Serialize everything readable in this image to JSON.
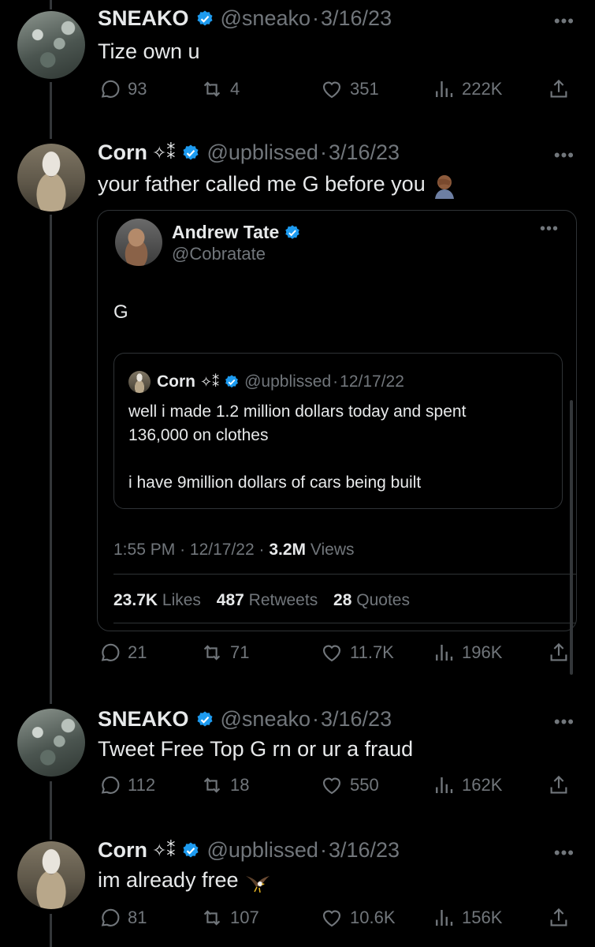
{
  "tweets": [
    {
      "name": "SNEAKO",
      "sparkles": "",
      "handle": "@sneako",
      "date": "3/16/23",
      "text": "Tize own u",
      "replies": "93",
      "retweets": "4",
      "likes": "351",
      "views": "222K"
    },
    {
      "name": "Corn",
      "sparkles": "✧⁑",
      "handle": "@upblissed",
      "date": "3/16/23",
      "text": "your father called me G before you",
      "text_emoji": "facepalm-emoji",
      "replies": "21",
      "retweets": "71",
      "likes": "11.7K",
      "views": "196K"
    },
    {
      "name": "SNEAKO",
      "sparkles": "",
      "handle": "@sneako",
      "date": "3/16/23",
      "text": "Tweet Free Top G rn or ur a fraud",
      "replies": "112",
      "retweets": "18",
      "likes": "550",
      "views": "162K"
    },
    {
      "name": "Corn",
      "sparkles": "✧⁑",
      "handle": "@upblissed",
      "date": "3/16/23",
      "text": "im already free",
      "text_emoji": "eagle-emoji",
      "replies": "81",
      "retweets": "107",
      "likes": "10.6K",
      "views": "156K"
    }
  ],
  "quoted": {
    "name": "Andrew Tate",
    "handle": "@Cobratate",
    "text": "G",
    "inner": {
      "name": "Corn",
      "sparkles": "✧⁑",
      "handle": "@upblissed",
      "date": "12/17/22",
      "line1": "well i made 1.2 million dollars today and spent",
      "line2": "136,000 on clothes",
      "line3": "i have 9million dollars of cars being built"
    },
    "time": "1:55 PM",
    "date": "12/17/22",
    "views_count": "3.2M",
    "views_label": "Views",
    "likes_count": "23.7K",
    "likes_label": "Likes",
    "retweets_count": "487",
    "retweets_label": "Retweets",
    "quotes_count": "28",
    "quotes_label": "Quotes"
  },
  "ui": {
    "dot": "·",
    "more": "•••"
  },
  "colors": {
    "background": "#000000",
    "text": "#e7e9ea",
    "muted": "#71767b",
    "verified": "#1d9bf0",
    "border": "#2f3336"
  },
  "icons": [
    "verified-badge-icon",
    "reply-icon",
    "retweet-icon",
    "like-icon",
    "views-icon",
    "share-icon",
    "more-icon"
  ]
}
